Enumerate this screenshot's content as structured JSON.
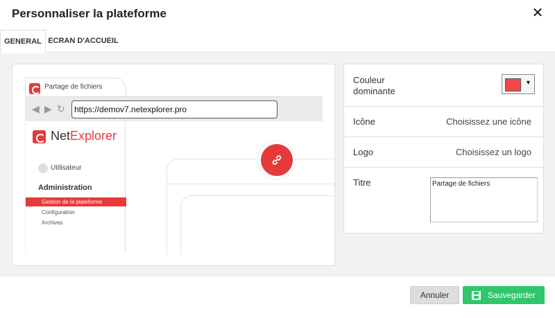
{
  "dialog": {
    "title": "Personnaliser la plateforme",
    "close_icon": "close-icon"
  },
  "tabs": [
    {
      "label": "GENERAL",
      "active": true
    },
    {
      "label": "ECRAN D'ACCUEIL",
      "active": false
    }
  ],
  "preview": {
    "tab_title": "Partage de fichiers",
    "nav_icons": [
      "arrow-left-icon",
      "arrow-right-icon",
      "refresh-icon"
    ],
    "url": "https://demov7.netexplorer.pro",
    "brand_net": "Net",
    "brand_explorer": "Explorer",
    "user_label": "Utilisateur",
    "admin_label": "Administration",
    "menu": [
      {
        "label": "Gestion de la plateforme",
        "active": true
      },
      {
        "label": "Configuration",
        "active": false
      },
      {
        "label": "Archives",
        "active": false
      }
    ],
    "fab_icon": "link-icon"
  },
  "settings": {
    "color_label": "Couleur dominante",
    "color_value": "#f04848",
    "icon_label": "Icône",
    "icon_action": "Choisissez une icône",
    "logo_label": "Logo",
    "logo_action": "Choisissez un logo",
    "title_label": "Titre",
    "title_value": "Partage de fichiers"
  },
  "footer": {
    "cancel_label": "Annuler",
    "save_label": "Sauvegarder",
    "save_icon": "save-icon"
  },
  "colors": {
    "accent": "#e63a3a",
    "save_button": "#2fc66c"
  }
}
